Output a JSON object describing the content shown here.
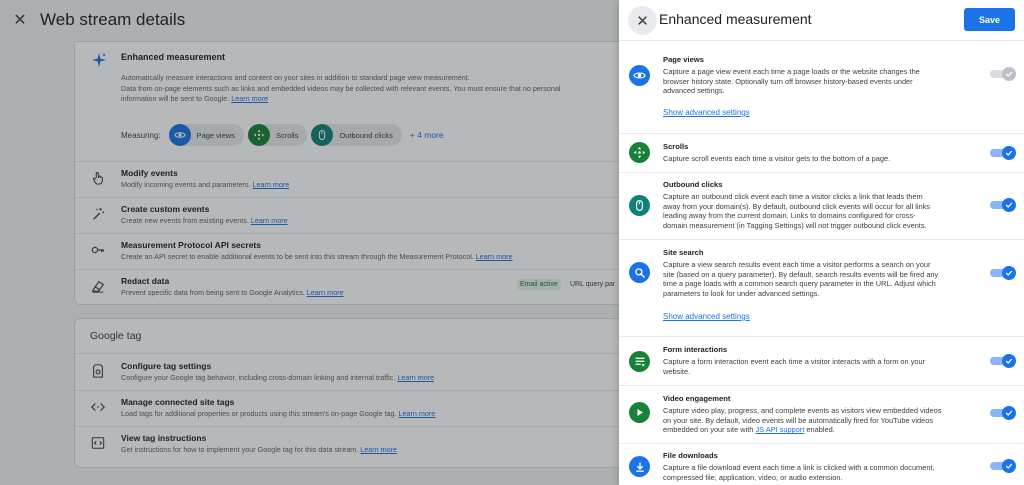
{
  "background": {
    "header": {
      "title": "Web stream details"
    },
    "enhanced": {
      "title": "Enhanced measurement",
      "desc_line1": "Automatically measure interactions and content on your sites in addition to standard page view measurement.",
      "desc_line2": "Data from on-page elements such as links and embedded videos may be collected with relevant events. You must ensure that no personal",
      "desc_line3": "information will be sent to Google.",
      "learn_more": "Learn more",
      "measuring_label": "Measuring:",
      "chips": [
        {
          "label": "Page views",
          "icon": "eye-icon",
          "color": "#1a73e8"
        },
        {
          "label": "Scrolls",
          "icon": "move-icon",
          "color": "#188038"
        },
        {
          "label": "Outbound clicks",
          "icon": "mouse-icon",
          "color": "#12807a"
        }
      ],
      "more": "+ 4 more"
    },
    "rows": [
      {
        "title": "Modify events",
        "desc": "Modify incoming events and parameters.",
        "link": "Learn more"
      },
      {
        "title": "Create custom events",
        "desc": "Create new events from existing events.",
        "link": "Learn more"
      },
      {
        "title": "Measurement Protocol API secrets",
        "desc": "Create an API secret to enable additional events to be sent into this stream through the Measurement Protocol.",
        "link": "Learn more"
      },
      {
        "title": "Redact data",
        "desc": "Prevent specific data from being sent to Google Analytics.",
        "link": "Learn more",
        "badge": "Email active",
        "extra": "URL query par"
      }
    ],
    "google_tag": {
      "title": "Google tag",
      "rows": [
        {
          "title": "Configure tag settings",
          "desc": "Configure your Google tag behavior, including cross-domain linking and internal traffic.",
          "link": "Learn more"
        },
        {
          "title": "Manage connected site tags",
          "desc": "Load tags for additional properties or products using this stream's on-page Google tag.",
          "link": "Learn more"
        },
        {
          "title": "View tag instructions",
          "desc": "Get instructions for how to implement your Google tag for this data stream.",
          "link": "Learn more"
        }
      ]
    }
  },
  "panel": {
    "title": "Enhanced measurement",
    "save_label": "Save",
    "settings": [
      {
        "title": "Page views",
        "lines": [
          "Capture a page view event each time a page loads or the website changes the",
          "browser history state. Optionally turn off browser history-based events under",
          "advanced settings."
        ],
        "advanced": "Show advanced settings",
        "icon": "eye-icon",
        "color": "#1a73e8",
        "state": "disabled"
      },
      {
        "title": "Scrolls",
        "lines": [
          "Capture scroll events each time a visitor gets to the bottom of a page."
        ],
        "icon": "move-icon",
        "color": "#188038",
        "state": "on"
      },
      {
        "title": "Outbound clicks",
        "lines": [
          "Capture an outbound click event each time a visitor clicks a link that leads them",
          "away from your domain(s). By default, outbound click events will occur for all links",
          "leading away from the current domain. Links to domains configured for cross-",
          "domain measurement (in Tagging Settings) will not trigger outbound click events."
        ],
        "icon": "mouse-icon",
        "color": "#12807a",
        "state": "on"
      },
      {
        "title": "Site search",
        "lines": [
          "Capture a view search results event each time a visitor performs a search on your",
          "site (based on a query parameter). By default, search results events will be fired any",
          "time a page loads with a common search query parameter in the URL. Adjust which",
          "parameters to look for under advanced settings."
        ],
        "advanced": "Show advanced settings",
        "icon": "search-icon",
        "color": "#1a73e8",
        "state": "on"
      },
      {
        "title": "Form interactions",
        "lines": [
          "Capture a form interaction event each time a visitor interacts with a form on your",
          "website."
        ],
        "icon": "form-icon",
        "color": "#188038",
        "state": "on"
      },
      {
        "title": "Video engagement",
        "lines": [
          "Capture video play, progress, and complete events as visitors view embedded videos",
          "on your site. By default, video events will be automatically fired for YouTube videos"
        ],
        "line_last_prefix": "embedded on your site with ",
        "line_last_link": "JS API support",
        "line_last_suffix": " enabled.",
        "icon": "play-icon",
        "color": "#188038",
        "state": "on"
      },
      {
        "title": "File downloads",
        "lines": [
          "Capture a file download event each time a link is clicked with a common document,",
          "compressed file, application, video, or audio extension."
        ],
        "icon": "download-icon",
        "color": "#1a73e8",
        "state": "on"
      }
    ]
  }
}
